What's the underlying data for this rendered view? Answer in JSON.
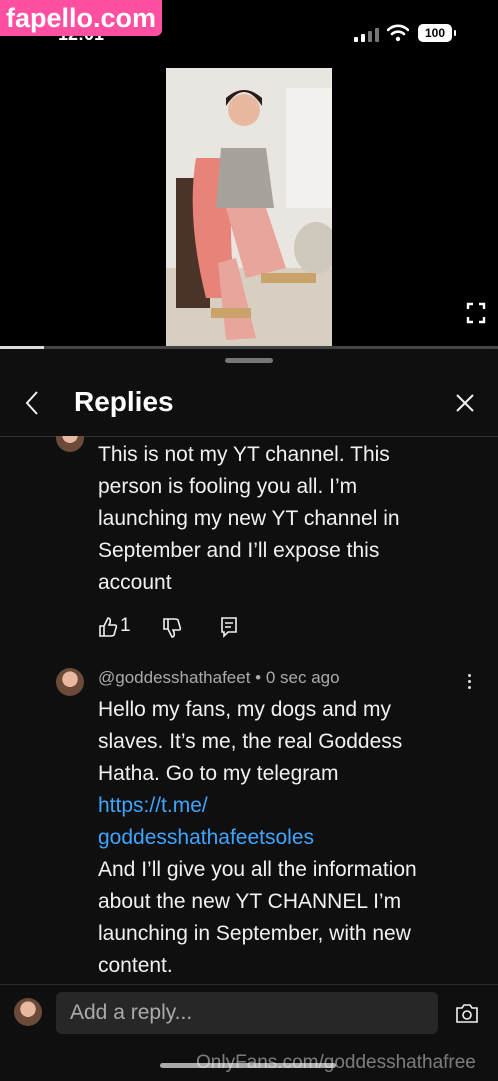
{
  "watermark_top": "fapello.com",
  "status": {
    "time": "12:01",
    "battery": "100"
  },
  "sheet": {
    "title": "Replies"
  },
  "comments": [
    {
      "text_lines": [
        "This is not my YT channel. This",
        "person is fooling you all. I’m",
        "launching my new YT channel in",
        "September and I’ll expose this",
        "account"
      ],
      "likes": "1"
    },
    {
      "handle": "@goddesshathafeet",
      "time": "0 sec ago",
      "text_lines_before_link": [
        "Hello my fans, my dogs and my",
        "slaves. It’s me, the real Goddess",
        "Hatha. Go to my telegram"
      ],
      "link_lines": [
        "https://t.me/",
        "goddesshathafeetsoles"
      ],
      "text_lines_after_link": [
        "And I’ll give you all the  information",
        "about the new YT CHANNEL I’m",
        "launching in September, with new",
        "content."
      ]
    }
  ],
  "reply_input": {
    "placeholder": "Add a reply..."
  },
  "watermark_bottom": "OnlyFans.com/goddesshathafree",
  "colors": {
    "background": "#0f0f0f",
    "link": "#3ea6ff",
    "watermark": "#ff4fa0"
  }
}
